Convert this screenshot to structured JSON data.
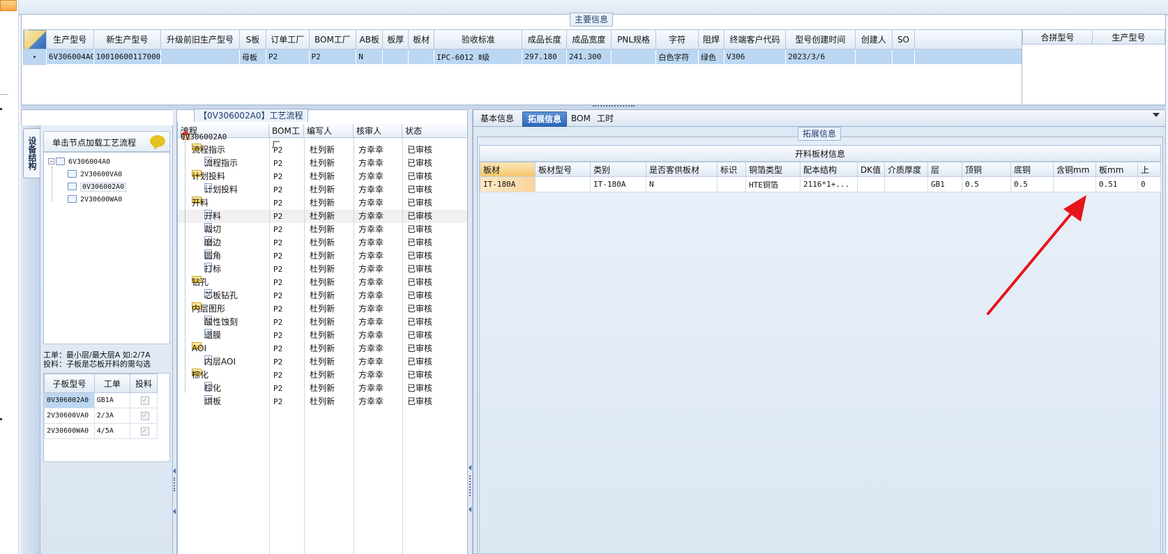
{
  "main_info": {
    "title": "主要信息",
    "columns": [
      "生产型号",
      "新生产型号",
      "升级前旧生产型号",
      "S板",
      "订单工厂",
      "BOM工厂",
      "AB板",
      "板厚",
      "板材",
      "验收标准",
      "成品长度",
      "成品宽度",
      "PNL规格",
      "字符",
      "阻焊",
      "终端客户代码",
      "型号创建时间",
      "创建人",
      "SO"
    ],
    "row": {
      "row_marker": "▸",
      "cells": [
        "6V306004A0",
        "10010600117000",
        "",
        "母板",
        "P2",
        "P2",
        "N",
        "",
        "",
        "IPC-6012 Ⅱ级",
        "297.180",
        "241.300",
        "",
        "白色字符",
        "绿色",
        "V306",
        "2023/3/6",
        "",
        ""
      ]
    },
    "side_columns": [
      "合拼型号",
      "生产型号"
    ]
  },
  "process_panel": {
    "title": "【0V306002A0】工艺流程",
    "vertical_tab": "设备结构",
    "device_header": "单击节点加载工艺流程",
    "device_tree": [
      {
        "label": "6V306004A0",
        "expander": "−"
      },
      {
        "label": "2V30600VA0"
      },
      {
        "label": "0V306002A0"
      },
      {
        "label": "2V30600WA0"
      }
    ],
    "hint_line1": "工单：最小层/最大层A 如:2/7A",
    "hint_line2": "投料：子板是芯板开料的需勾选",
    "sub_grid": {
      "columns": [
        "子板型号",
        "工单",
        "投料"
      ],
      "rows": [
        {
          "model": "0V306002A0",
          "order": "GB1A",
          "feed": "✓"
        },
        {
          "model": "2V30600VA0",
          "order": "2/3A",
          "feed": "✓"
        },
        {
          "model": "2V30600WA0",
          "order": "4/5A",
          "feed": "✓"
        }
      ]
    },
    "flow_columns": [
      "流程",
      "BOM工厂",
      "编写人",
      "核审人",
      "状态"
    ],
    "flow_root": "0V306002A0",
    "flow_rows": [
      {
        "name": "流程指示",
        "kind": "folder",
        "factory": "P2",
        "writer": "杜列新",
        "reviewer": "方幸幸",
        "status": "已审核"
      },
      {
        "name": "流程指示",
        "kind": "doc",
        "factory": "P2",
        "writer": "杜列新",
        "reviewer": "方幸幸",
        "status": "已审核"
      },
      {
        "name": "计划投料",
        "kind": "folder",
        "factory": "P2",
        "writer": "杜列新",
        "reviewer": "方幸幸",
        "status": "已审核"
      },
      {
        "name": "计划投料",
        "kind": "doc",
        "factory": "P2",
        "writer": "杜列新",
        "reviewer": "方幸幸",
        "status": "已审核"
      },
      {
        "name": "开料",
        "kind": "folder",
        "factory": "P2",
        "writer": "杜列新",
        "reviewer": "方幸幸",
        "status": "已审核"
      },
      {
        "name": "开料",
        "kind": "doc",
        "factory": "P2",
        "writer": "杜列新",
        "reviewer": "方幸幸",
        "status": "已审核"
      },
      {
        "name": "裁切",
        "kind": "doc",
        "factory": "P2",
        "writer": "杜列新",
        "reviewer": "方幸幸",
        "status": "已审核"
      },
      {
        "name": "磨边",
        "kind": "doc",
        "factory": "P2",
        "writer": "杜列新",
        "reviewer": "方幸幸",
        "status": "已审核"
      },
      {
        "name": "圆角",
        "kind": "doc",
        "factory": "P2",
        "writer": "杜列新",
        "reviewer": "方幸幸",
        "status": "已审核"
      },
      {
        "name": "打标",
        "kind": "doc",
        "factory": "P2",
        "writer": "杜列新",
        "reviewer": "方幸幸",
        "status": "已审核"
      },
      {
        "name": "钻孔",
        "kind": "folder",
        "factory": "P2",
        "writer": "杜列新",
        "reviewer": "方幸幸",
        "status": "已审核"
      },
      {
        "name": "芯板钻孔",
        "kind": "doc",
        "factory": "P2",
        "writer": "杜列新",
        "reviewer": "方幸幸",
        "status": "已审核"
      },
      {
        "name": "内层图形",
        "kind": "folder",
        "factory": "P2",
        "writer": "杜列新",
        "reviewer": "方幸幸",
        "status": "已审核"
      },
      {
        "name": "酸性蚀刻",
        "kind": "doc",
        "factory": "P2",
        "writer": "杜列新",
        "reviewer": "方幸幸",
        "status": "已审核"
      },
      {
        "name": "退膜",
        "kind": "doc",
        "factory": "P2",
        "writer": "杜列新",
        "reviewer": "方幸幸",
        "status": "已审核"
      },
      {
        "name": "AOI",
        "kind": "folder",
        "factory": "P2",
        "writer": "杜列新",
        "reviewer": "方幸幸",
        "status": "已审核"
      },
      {
        "name": "内层AOI",
        "kind": "doc",
        "factory": "P2",
        "writer": "杜列新",
        "reviewer": "方幸幸",
        "status": "已审核"
      },
      {
        "name": "棕化",
        "kind": "folder",
        "factory": "P2",
        "writer": "杜列新",
        "reviewer": "方幸幸",
        "status": "已审核"
      },
      {
        "name": "棕化",
        "kind": "doc",
        "factory": "P2",
        "writer": "杜列新",
        "reviewer": "方幸幸",
        "status": "已审核"
      },
      {
        "name": "烘板",
        "kind": "doc",
        "factory": "P2",
        "writer": "杜列新",
        "reviewer": "方幸幸",
        "status": "已审核"
      }
    ]
  },
  "detail_tabs": [
    {
      "label": "基本信息",
      "active": false
    },
    {
      "label": "拓展信息",
      "active": true
    },
    {
      "label": "BOM",
      "active": false
    },
    {
      "label": "工时",
      "active": false
    }
  ],
  "extended": {
    "group_title": "拓展信息",
    "cut_title": "开料板材信息",
    "columns": [
      "板材",
      "板材型号",
      "类别",
      "是否客供板材",
      "标识",
      "铜箔类型",
      "配本结构",
      "DK值",
      "介质厚度",
      "层",
      "顶铜",
      "底铜",
      "含铜mm",
      "板mm",
      "上"
    ],
    "row": [
      "IT-180A",
      "",
      "IT-180A",
      "N",
      "",
      "HTE铜箔",
      "2116*1+...",
      "",
      "",
      "GB1",
      "0.5",
      "0.5",
      "",
      "0.51",
      "0"
    ]
  },
  "colors": {
    "accent": "#2d67b8",
    "selection": "#bcd7f2",
    "annotation_arrow": "#e8141c"
  }
}
